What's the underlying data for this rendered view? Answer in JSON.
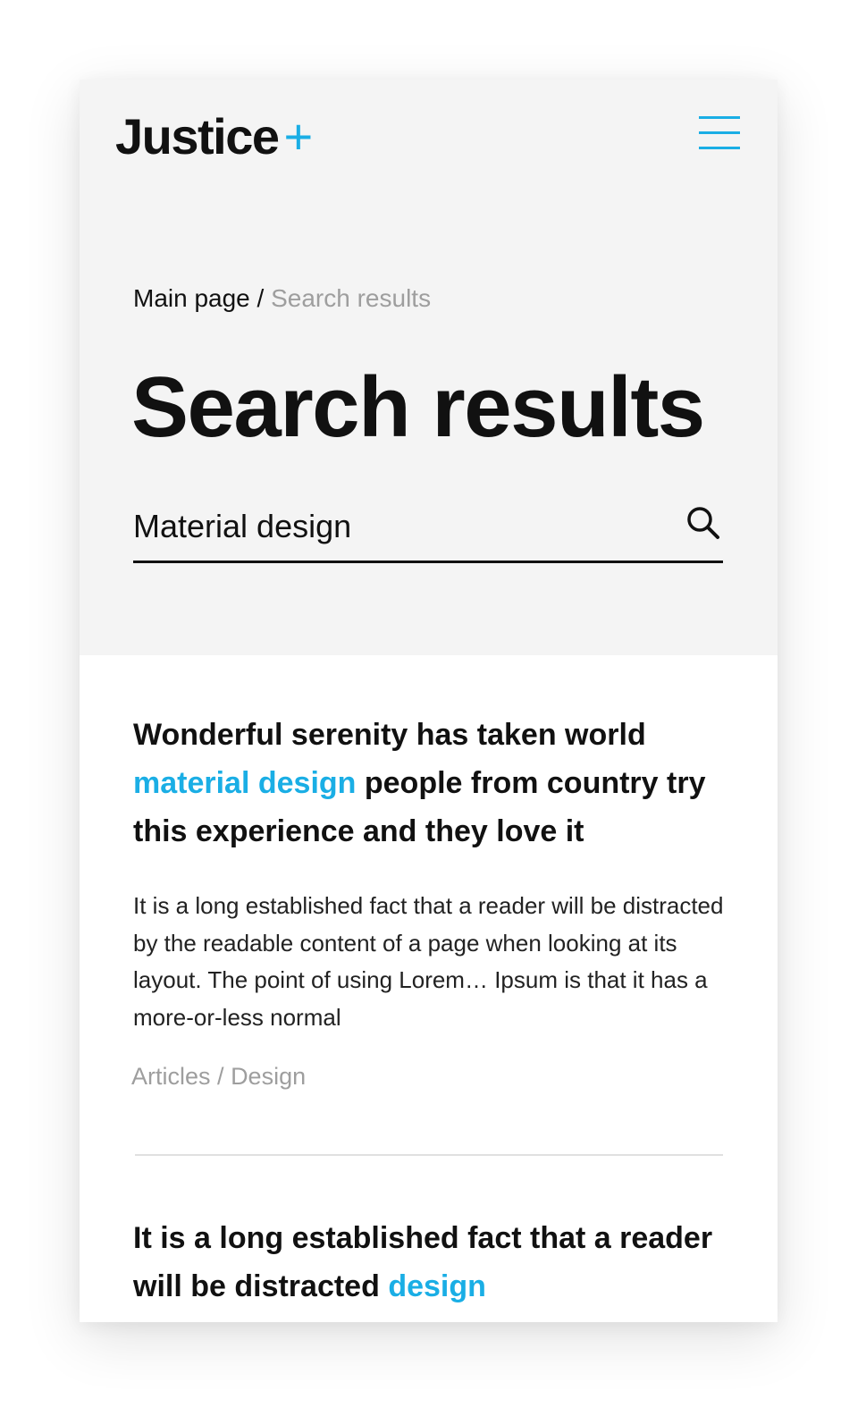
{
  "header": {
    "logo_text": "Justice",
    "logo_plus": "+",
    "menu_icon": "hamburger-menu-icon",
    "accent_color": "#1aaee5"
  },
  "breadcrumb": {
    "home": "Main page",
    "separator": "/",
    "current": "Search results"
  },
  "page_title": "Search results",
  "search": {
    "value": "Material design",
    "icon": "search-icon"
  },
  "results": [
    {
      "title_parts": [
        "Wonderful serenity has taken world ",
        "material design",
        " people from country try this experience and they love it"
      ],
      "excerpt": "It is a long established fact that a reader will be distracted by the readable content of a page when looking at its layout. The point of using Lorem… Ipsum is that it has a more-or-less normal",
      "category": "Articles",
      "category_separator": "/",
      "subcategory": "Design"
    },
    {
      "title_parts": [
        "It is a long established fact that a reader will be distracted ",
        "design"
      ]
    }
  ]
}
